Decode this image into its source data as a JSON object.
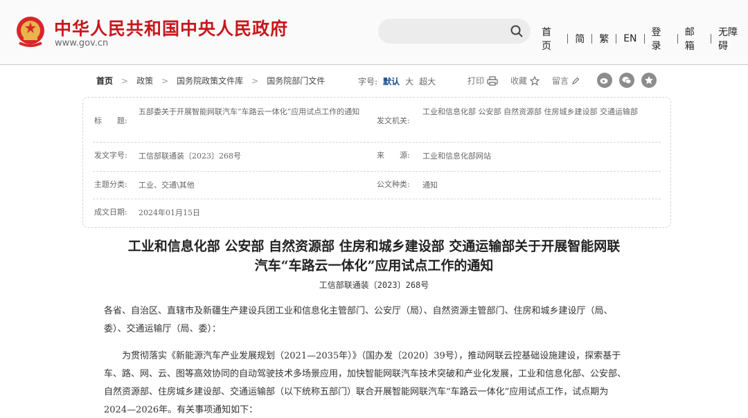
{
  "header": {
    "site_title": "中华人民共和国中央人民政府",
    "site_url": "www.gov.cn",
    "search_placeholder": "",
    "nav": [
      "首页",
      "简",
      "繁",
      "EN",
      "登录",
      "邮箱",
      "无障碍"
    ]
  },
  "breadcrumb": [
    "首页",
    "政策",
    "国务院政策文件库",
    "国务院部门文件"
  ],
  "font_size": {
    "label": "字号:",
    "options": [
      "默认",
      "大",
      "超大"
    ]
  },
  "tools": {
    "print": "打印",
    "favorite": "收藏",
    "comment": "留言"
  },
  "share_icons": [
    "weibo-icon",
    "wechat-icon",
    "qzone-icon"
  ],
  "info": {
    "title_label": "标　　题:",
    "title_value": "五部委关于开展智能网联汽车“车路云一体化”应用试点工作的通知",
    "issuer_label": "发文机关:",
    "issuer_value": "工业和信息化部 公安部 自然资源部 住房城乡建设部 交通运输部",
    "docno_label": "发文字号:",
    "docno_value": "工信部联通装〔2023〕268号",
    "source_label": "来　　源:",
    "source_value": "工业和信息化部网站",
    "category_label": "主题分类:",
    "category_value": "工业、交通\\其他",
    "type_label": "公文种类:",
    "type_value": "通知",
    "date_label": "成文日期:",
    "date_value": "2024年01月15日"
  },
  "article": {
    "title_line1": "工业和信息化部 公安部 自然资源部 住房和城乡建设部 交通运输部关于开展智能网联",
    "title_line2": "汽车“车路云一体化”应用试点工作的通知",
    "doc_number": "工信部联通装〔2023〕268号",
    "salutation_line1": "各省、自治区、直辖市及新疆生产建设兵团工业和信息化主管部门、公安厅（局）、自然资源主管部门、住房和城乡建设厅（局、",
    "salutation_line2": "委）、交通运输厅（局、委）：",
    "para_lines": [
      "　　为贯彻落实《新能源汽车产业发展规划（2021—2035年）》（国办发〔2020〕39号），推动网联云控基础设施建设，探索基于",
      "车、路、网、云、图等高效协同的自动驾驶技术多场景应用，加快智能网联汽车技术突破和产业化发展，工业和信息化部、公安部、",
      "自然资源部、住房城乡建设部、交通运输部（以下统称五部门）联合开展智能网联汽车“车路云一体化”应用试点工作，试点期为",
      "2024—2026年。有关事项通知如下："
    ]
  },
  "colors": {
    "brand_red": "#c8161d",
    "active_blue": "#1a4d8f",
    "share_grey": "#8c8c8c"
  }
}
